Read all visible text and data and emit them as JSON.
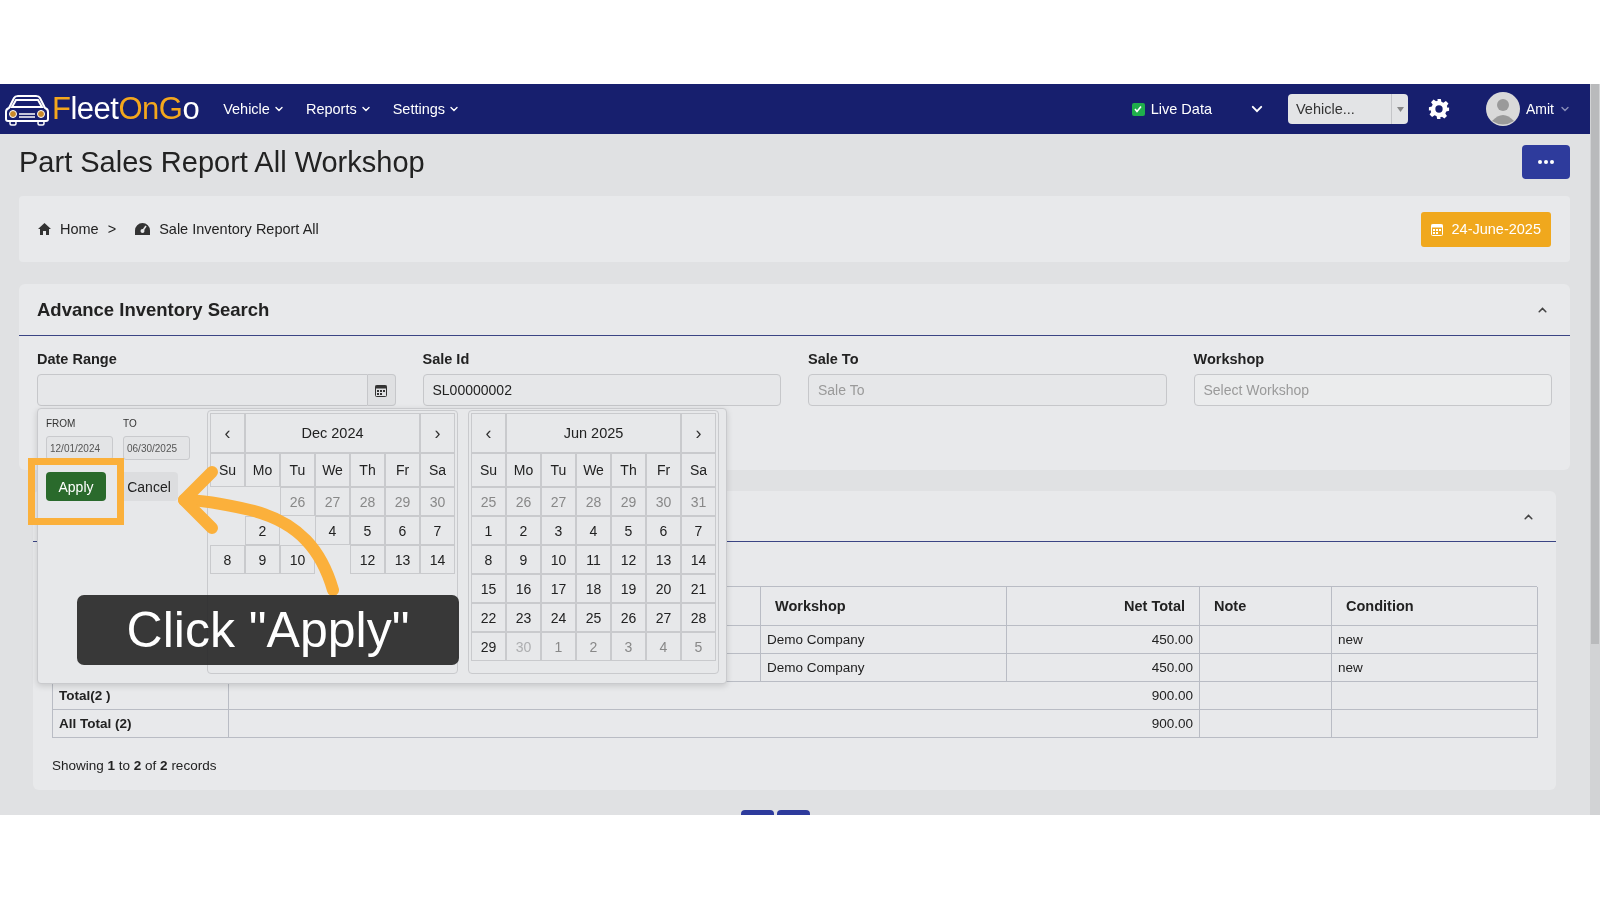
{
  "header": {
    "logo": [
      {
        "text": "F",
        "accent": true
      },
      {
        "text": "leet",
        "accent": false
      },
      {
        "text": "OnG",
        "accent": true
      },
      {
        "text": "o",
        "accent": false
      }
    ],
    "nav": [
      {
        "label": "Vehicle"
      },
      {
        "label": "Reports"
      },
      {
        "label": "Settings"
      }
    ],
    "live_data": {
      "label": "Live Data",
      "checked": true
    },
    "vehicle_select": {
      "value": "Vehicle..."
    },
    "user": {
      "name": "Amit"
    }
  },
  "page": {
    "title": "Part Sales Report All Workshop",
    "separator": ">",
    "breadcrumbs": [
      {
        "label": "Home"
      },
      {
        "label": "Sale Inventory Report All"
      }
    ],
    "date_badge": "24-June-2025"
  },
  "search": {
    "title": "Advance Inventory Search",
    "expanded": true,
    "fields": [
      {
        "label": "Date Range",
        "kind": "date"
      },
      {
        "label": "Sale Id",
        "kind": "text",
        "value": "SL00000002"
      },
      {
        "label": "Sale To",
        "kind": "text",
        "placeholder": "Sale To"
      },
      {
        "label": "Workshop",
        "kind": "select",
        "placeholder": "Select Workshop"
      }
    ]
  },
  "report": {
    "expanded": true,
    "table": {
      "columns": [
        "Workshop",
        "Net Total",
        "Note",
        "Condition"
      ],
      "rows": [
        {
          "workshop": "Demo Company",
          "net_total": "450.00",
          "condition": "new"
        },
        {
          "workshop": "Demo Company",
          "net_total": "450.00",
          "condition": "new"
        }
      ],
      "totals": [
        {
          "label": "Total(2 )",
          "value": "900.00"
        },
        {
          "label": "All Total (2)",
          "value": "900.00"
        }
      ]
    },
    "footer": "Showing **1** to **2** of **2** records"
  },
  "date_picker": {
    "from_label": "FROM",
    "from": "12/01/2024",
    "to_label": "TO",
    "to": "06/30/2025",
    "apply": "Apply",
    "cancel": "Cancel",
    "prev": "‹",
    "next": "›",
    "calendars": [
      {
        "title": "Dec 2024",
        "weekdays": [
          "Su",
          "Mo",
          "Tu",
          "We",
          "Th",
          "Fr",
          "Sa"
        ],
        "weeks": [
          {
            "days": [
              {
                "kind": "covered"
              },
              {
                "kind": "covered"
              },
              {
                "d": "26",
                "kind": "out"
              },
              {
                "d": "27",
                "kind": "out"
              },
              {
                "d": "28",
                "kind": "out"
              },
              {
                "d": "29",
                "kind": "out"
              },
              {
                "d": "30",
                "kind": "out"
              }
            ]
          },
          {
            "days": [
              {
                "kind": "covered"
              },
              {
                "d": "2",
                "kind": "in"
              },
              {
                "kind": "covered"
              },
              {
                "d": "4",
                "kind": "in"
              },
              {
                "d": "5",
                "kind": "in"
              },
              {
                "d": "6",
                "kind": "in"
              },
              {
                "d": "7",
                "kind": "in"
              }
            ]
          },
          {
            "days": [
              {
                "d": "8",
                "kind": "in"
              },
              {
                "d": "9",
                "kind": "in"
              },
              {
                "d": "10",
                "kind": "in"
              },
              {
                "kind": "covered"
              },
              {
                "d": "12",
                "kind": "in"
              },
              {
                "d": "13",
                "kind": "in"
              },
              {
                "d": "14",
                "kind": "in"
              }
            ]
          },
          {
            "days": [
              {
                "kind": "covered"
              },
              {
                "kind": "covered"
              },
              {
                "kind": "covered"
              },
              {
                "kind": "covered"
              },
              {
                "kind": "covered"
              },
              {
                "kind": "covered"
              },
              {
                "kind": "covered"
              }
            ]
          },
          {
            "days": [
              {
                "kind": "covered"
              },
              {
                "kind": "covered"
              },
              {
                "kind": "covered"
              },
              {
                "kind": "covered"
              },
              {
                "kind": "covered"
              },
              {
                "kind": "covered"
              },
              {
                "kind": "covered"
              }
            ]
          },
          {
            "days": [
              {
                "kind": "covered"
              },
              {
                "kind": "covered"
              },
              {
                "kind": "covered"
              },
              {
                "kind": "covered"
              },
              {
                "kind": "covered"
              },
              {
                "kind": "covered"
              },
              {
                "kind": "covered"
              }
            ]
          }
        ]
      },
      {
        "title": "Jun 2025",
        "weekdays": [
          "Su",
          "Mo",
          "Tu",
          "We",
          "Th",
          "Fr",
          "Sa"
        ],
        "weeks": [
          {
            "days": [
              {
                "d": "25",
                "kind": "out"
              },
              {
                "d": "26",
                "kind": "out"
              },
              {
                "d": "27",
                "kind": "out"
              },
              {
                "d": "28",
                "kind": "out"
              },
              {
                "d": "29",
                "kind": "out"
              },
              {
                "d": "30",
                "kind": "out"
              },
              {
                "d": "31",
                "kind": "out"
              }
            ]
          },
          {
            "days": [
              {
                "d": "1",
                "kind": "in"
              },
              {
                "d": "2",
                "kind": "in"
              },
              {
                "d": "3",
                "kind": "in"
              },
              {
                "d": "4",
                "kind": "in"
              },
              {
                "d": "5",
                "kind": "in"
              },
              {
                "d": "6",
                "kind": "in"
              },
              {
                "d": "7",
                "kind": "in"
              }
            ]
          },
          {
            "days": [
              {
                "d": "8",
                "kind": "in"
              },
              {
                "d": "9",
                "kind": "in"
              },
              {
                "d": "10",
                "kind": "in"
              },
              {
                "d": "11",
                "kind": "in"
              },
              {
                "d": "12",
                "kind": "in"
              },
              {
                "d": "13",
                "kind": "in"
              },
              {
                "d": "14",
                "kind": "in"
              }
            ]
          },
          {
            "days": [
              {
                "d": "15",
                "kind": "in"
              },
              {
                "d": "16",
                "kind": "in"
              },
              {
                "d": "17",
                "kind": "in"
              },
              {
                "d": "18",
                "kind": "in"
              },
              {
                "d": "19",
                "kind": "in"
              },
              {
                "d": "20",
                "kind": "in"
              },
              {
                "d": "21",
                "kind": "in"
              }
            ]
          },
          {
            "days": [
              {
                "d": "22",
                "kind": "in"
              },
              {
                "d": "23",
                "kind": "in"
              },
              {
                "d": "24",
                "kind": "in"
              },
              {
                "d": "25",
                "kind": "in"
              },
              {
                "d": "26",
                "kind": "in"
              },
              {
                "d": "27",
                "kind": "in"
              },
              {
                "d": "28",
                "kind": "in"
              }
            ]
          },
          {
            "days": [
              {
                "d": "29",
                "kind": "in"
              },
              {
                "d": "30",
                "kind": "disabled"
              },
              {
                "d": "1",
                "kind": "out"
              },
              {
                "d": "2",
                "kind": "out"
              },
              {
                "d": "3",
                "kind": "out"
              },
              {
                "d": "4",
                "kind": "out"
              },
              {
                "d": "5",
                "kind": "out"
              }
            ]
          }
        ]
      }
    ]
  },
  "tutorial": {
    "caption": "Click \"Apply\""
  }
}
